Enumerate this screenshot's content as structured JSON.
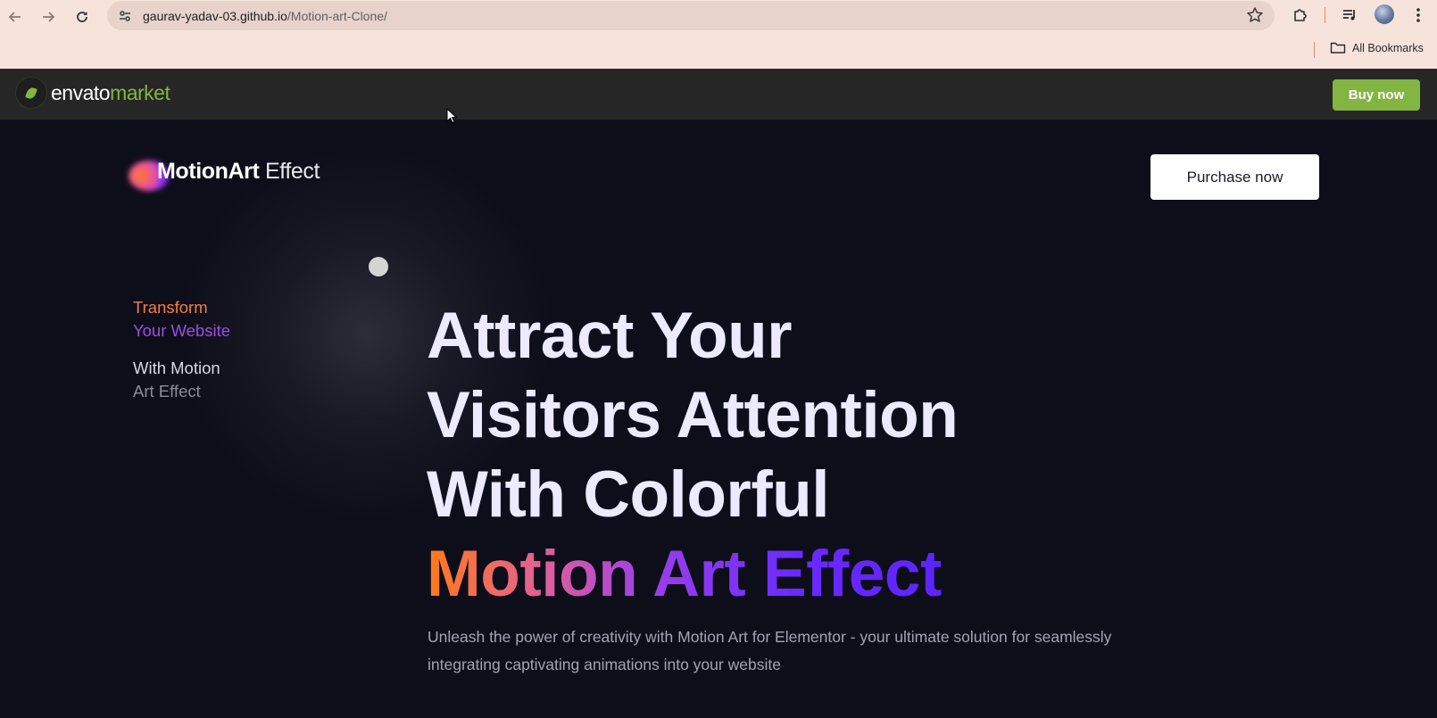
{
  "browser": {
    "url_host": "gaurav-yadav-03.github.io",
    "url_path": "/Motion-art-Clone/",
    "bookmarks_label": "All Bookmarks",
    "icons": {
      "back": "back-arrow-icon",
      "forward": "forward-arrow-icon",
      "reload": "reload-icon",
      "site_info": "tune-icon",
      "bookmark_star": "star-icon",
      "extensions": "puzzle-icon",
      "media": "playlist-icon",
      "menu": "kebab-menu-icon",
      "folder": "folder-icon"
    }
  },
  "envato": {
    "logo_word": "envato",
    "logo_market": "market",
    "buy_button": "Buy now",
    "brand_color": "#82b541"
  },
  "site": {
    "logo_bold": "MotionArt",
    "logo_light": " Effect",
    "purchase_button": "Purchase now",
    "side_lines": [
      "Transform",
      "Your Website",
      "With Motion",
      "Art Effect"
    ],
    "headline": [
      "Attract Your",
      "Visitors Attention",
      "With Colorful",
      "Motion Art Effect"
    ],
    "description": "Unleash the power of creativity with Motion Art for Elementor - your ultimate solution for seamlessly integrating captivating animations into your website",
    "colors": {
      "background": "#0e0e1b",
      "headline": "#ede9ff",
      "gradient_start": "#ff7a1a",
      "gradient_end": "#5a24ff"
    }
  }
}
